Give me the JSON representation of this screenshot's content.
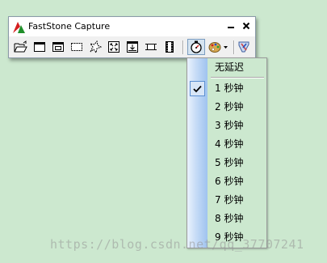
{
  "window": {
    "title": "FastStone Capture",
    "minimize_icon": "minimize-icon",
    "close_icon": "close-icon"
  },
  "toolbar": {
    "tools": [
      {
        "name": "open-file-icon"
      },
      {
        "name": "capture-active-window-icon"
      },
      {
        "name": "capture-window-object-icon"
      },
      {
        "name": "capture-rectangle-icon"
      },
      {
        "name": "capture-freehand-icon"
      },
      {
        "name": "capture-full-screen-icon"
      },
      {
        "name": "capture-scrolling-window-icon"
      },
      {
        "name": "capture-fixed-region-icon"
      },
      {
        "name": "screen-recorder-icon"
      },
      {
        "name": "delay-timer-icon"
      },
      {
        "name": "output-destination-icon"
      },
      {
        "name": "settings-icon"
      }
    ]
  },
  "delay_menu": {
    "items": [
      {
        "label": "无延迟",
        "checked": false
      },
      {
        "label": "1 秒钟",
        "checked": true
      },
      {
        "label": "2 秒钟",
        "checked": false
      },
      {
        "label": "3 秒钟",
        "checked": false
      },
      {
        "label": "4 秒钟",
        "checked": false
      },
      {
        "label": "5 秒钟",
        "checked": false
      },
      {
        "label": "6 秒钟",
        "checked": false
      },
      {
        "label": "7 秒钟",
        "checked": false
      },
      {
        "label": "8 秒钟",
        "checked": false
      },
      {
        "label": "9 秒钟",
        "checked": false
      }
    ]
  },
  "watermark": {
    "text": "https://blog.csdn.net/qq_37707241"
  },
  "colors": {
    "background": "#cce8cf",
    "menu_gutter": "#9fc3ef",
    "check_border": "#5b8fd1"
  }
}
